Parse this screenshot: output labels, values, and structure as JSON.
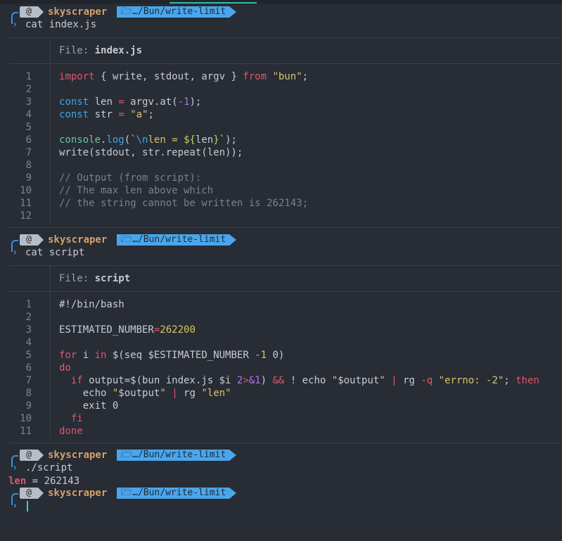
{
  "prompt": {
    "os_icon": "debian-swirl-icon",
    "os_glyph": "@",
    "host": "skyscraper",
    "path_icon": "folder-open-icon",
    "path_glyph": "🗁",
    "path": "…/Bun/write-limit"
  },
  "commands": [
    "cat index.js",
    "cat script",
    "./script",
    ""
  ],
  "files": [
    {
      "label": "File:",
      "name": "index.js",
      "lines": [
        "1",
        "2",
        "3",
        "4",
        "5",
        "6",
        "7",
        "8",
        "9",
        "10",
        "11",
        "12"
      ]
    },
    {
      "label": "File:",
      "name": "script",
      "lines": [
        "1",
        "2",
        "3",
        "4",
        "5",
        "6",
        "7",
        "8",
        "9",
        "10",
        "11"
      ]
    }
  ],
  "output": {
    "key": "len",
    "rest": " = 262143"
  },
  "colors": {
    "background": "#272c35",
    "accent_blue": "#4aa6ec",
    "host": "#d7a06b",
    "keyword": "#e0566b",
    "string": "#d8c567"
  }
}
